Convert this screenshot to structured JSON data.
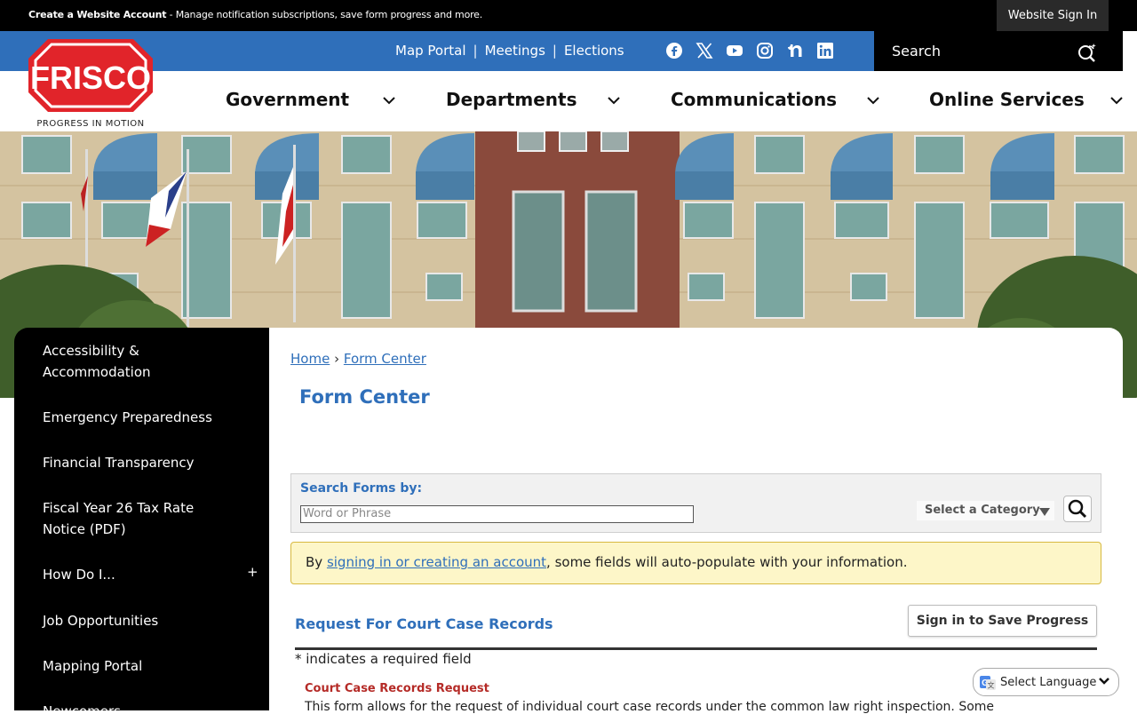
{
  "topbar": {
    "account_link": "Create a Website Account",
    "account_text": " - Manage notification subscriptions, save form progress and more.",
    "sign_in": "Website Sign In"
  },
  "quicklinks": [
    "Map Portal",
    "Meetings",
    "Elections"
  ],
  "social_icons": [
    "facebook-icon",
    "x-icon",
    "youtube-icon",
    "instagram-icon",
    "nextdoor-icon",
    "linkedin-icon"
  ],
  "search": {
    "placeholder": "Search"
  },
  "logo": {
    "name": "FRISCO",
    "tagline": "PROGRESS IN MOTION"
  },
  "nav": [
    "Government",
    "Departments",
    "Communications",
    "Online Services"
  ],
  "sidebar": {
    "items": [
      "Accessibility & Accommodation",
      "Emergency Preparedness",
      "Financial Transparency",
      "Fiscal Year 26 Tax Rate Notice (PDF)",
      "How Do I...",
      "Job Opportunities",
      "Mapping Portal",
      "Newcomers"
    ],
    "expand_symbol": "+"
  },
  "breadcrumb": {
    "home": "Home",
    "sep": "›",
    "current": "Form Center"
  },
  "page_title": "Form Center",
  "form_search": {
    "label": "Search Forms by:",
    "placeholder": "Word or Phrase",
    "category": "Select a Category"
  },
  "notice": {
    "prefix": "By ",
    "link": "signing in or creating an account",
    "suffix": ", some fields will auto-populate with your information."
  },
  "form": {
    "title": "Request For Court Case Records",
    "save_button": "Sign in to Save Progress",
    "required_note": "* indicates a required field",
    "section_heading": "Court Case Records Request",
    "description": "This form allows for the request of individual court case records under the common law right inspection. Some"
  },
  "language": {
    "label": "Select Language"
  },
  "colors": {
    "brand_blue": "#2f6fba",
    "logo_red": "#e1242a",
    "notice_bg": "#fdf6c8"
  }
}
